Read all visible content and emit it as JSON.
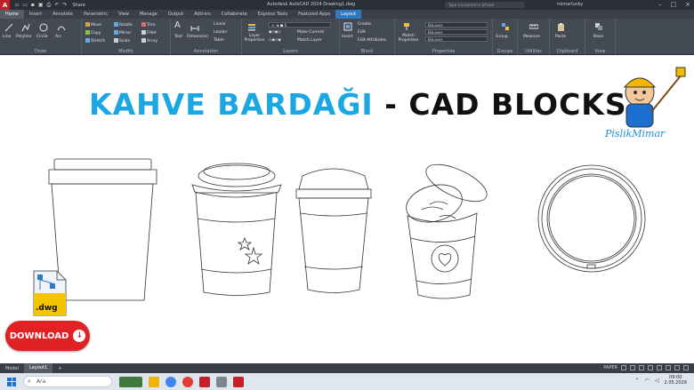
{
  "titlebar": {
    "logo": "A",
    "share_label": "Share",
    "doc_title": "Autodesk AutoCAD 2024   Drawing1.dwg",
    "search_placeholder": "Type a keyword or phrase",
    "user": "mimarlucky",
    "qat_icons": [
      "new-icon",
      "open-icon",
      "save-icon",
      "saveas-icon",
      "print-icon",
      "undo-icon",
      "redo-icon"
    ]
  },
  "tabs": [
    "Home",
    "Insert",
    "Annotate",
    "Parametric",
    "View",
    "Manage",
    "Output",
    "Add-ins",
    "Collaborate",
    "Express Tools",
    "Featured Apps",
    "Layout"
  ],
  "ribbon": {
    "draw": {
      "title": "Draw",
      "tools": [
        "Line",
        "Polyline",
        "Circle",
        "Arc"
      ]
    },
    "modify": {
      "title": "Modify",
      "tools": [
        "Move",
        "Rotate",
        "Trim",
        "Copy",
        "Mirror",
        "Fillet",
        "Stretch",
        "Scale",
        "Array"
      ]
    },
    "annotation": {
      "title": "Annotation",
      "tools": [
        "Text",
        "Dimension",
        "Linear",
        "Leader",
        "Table"
      ]
    },
    "layers": {
      "title": "Layers",
      "tools": [
        "Layer Properties",
        "Make Current",
        "Match Layer"
      ]
    },
    "block": {
      "title": "Block",
      "tools": [
        "Insert",
        "Create",
        "Edit",
        "Edit Attributes"
      ]
    },
    "properties": {
      "title": "Properties",
      "tools": [
        "Match Properties"
      ],
      "dropdowns": [
        "ByLayer",
        "ByLayer",
        "ByLayer"
      ]
    },
    "groups": {
      "title": "Groups",
      "tools": [
        "Group"
      ]
    },
    "utilities": {
      "title": "Utilities",
      "tools": [
        "Measure"
      ]
    },
    "clipboard": {
      "title": "Clipboard",
      "tools": [
        "Paste"
      ]
    },
    "view": {
      "title": "View",
      "tools": [
        "Base"
      ]
    }
  },
  "canvas": {
    "title_part1": "KAHVE BARDAĞI",
    "title_sep": " - ",
    "title_part2": "CAD BLOCKS",
    "brand": "PislikMimar",
    "dwg_label": ".dwg",
    "download_label": "DOWNLOAD"
  },
  "layout_tabs": [
    "Model",
    "Layout1",
    "+"
  ],
  "status": {
    "paper": "PAPER"
  },
  "taskbar": {
    "search_placeholder": "Ara",
    "time": "09:00",
    "date": "2.05.2026"
  },
  "colors": {
    "title_blue": "#1aa7e3",
    "title_black": "#111111",
    "download_red": "#e12225",
    "ribbon_bg": "#444a53",
    "layout_tab": "#2f78c2"
  }
}
